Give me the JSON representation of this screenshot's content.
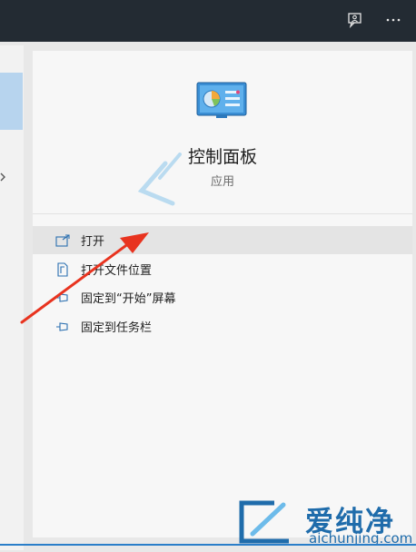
{
  "app": {
    "title": "控制面板",
    "subtitle": "应用"
  },
  "menu": [
    {
      "label": "打开",
      "icon": "open-icon"
    },
    {
      "label": "打开文件位置",
      "icon": "folder-location-icon"
    },
    {
      "label": "固定到“开始”屏幕",
      "icon": "pin-start-icon"
    },
    {
      "label": "固定到任务栏",
      "icon": "pin-taskbar-icon"
    }
  ],
  "watermark": {
    "brand": "爱纯净",
    "url": "aichunjing.com"
  },
  "colors": {
    "topbar": "#232b33",
    "accent": "#2a7ec9",
    "arrow": "#e8331f"
  }
}
